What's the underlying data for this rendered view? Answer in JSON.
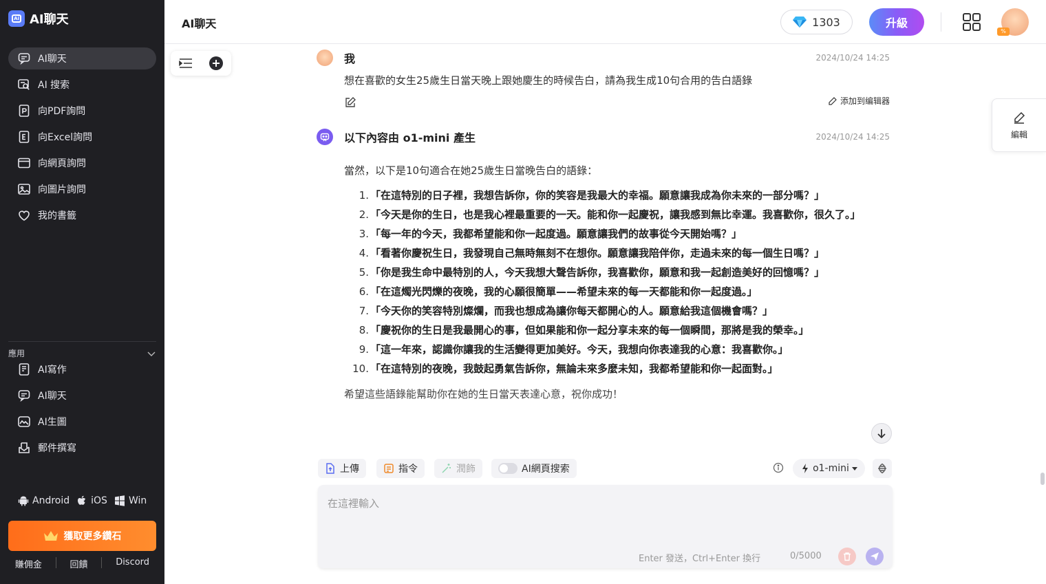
{
  "brand": {
    "name": "AI聊天",
    "logo_text": "Ai"
  },
  "sidebar": {
    "items": [
      {
        "label": "AI聊天",
        "icon": "chat-icon",
        "active": true
      },
      {
        "label": "AI 搜索",
        "icon": "search-icon"
      },
      {
        "label": "向PDF詢問",
        "icon": "pdf-icon"
      },
      {
        "label": "向Excel詢問",
        "icon": "excel-icon"
      },
      {
        "label": "向網頁詢問",
        "icon": "webpage-icon"
      },
      {
        "label": "向圖片詢問",
        "icon": "image-icon"
      },
      {
        "label": "我的書籤",
        "icon": "heart-icon"
      }
    ],
    "apps_label": "應用",
    "apps": [
      {
        "label": "AI寫作",
        "icon": "writing-icon"
      },
      {
        "label": "AI聊天",
        "icon": "chat-icon"
      },
      {
        "label": "AI生圖",
        "icon": "image-gen-icon"
      },
      {
        "label": "郵件撰寫",
        "icon": "mail-icon"
      }
    ],
    "platforms": [
      {
        "label": "Android",
        "icon": "android-icon"
      },
      {
        "label": "iOS",
        "icon": "apple-icon"
      },
      {
        "label": "Win",
        "icon": "windows-icon"
      }
    ],
    "cta_label": "獲取更多鑽石",
    "footer_links": [
      "賺佣金",
      "回饋",
      "Discord"
    ]
  },
  "header": {
    "title": "AI聊天",
    "diamonds": "1303",
    "upgrade_label": "升級",
    "accent_gradient": [
      "#5b8cf7",
      "#8a5cf7",
      "#b04cf0"
    ]
  },
  "edit_tab": {
    "label": "編輯"
  },
  "user_message": {
    "author": "我",
    "time": "2024/10/24 14:25",
    "text": "想在喜歡的女生25歲生日當天晚上跟她慶生的時候告白，請為我生成10句合用的告白語錄",
    "add_to_editor": "添加到编辑器"
  },
  "ai_message": {
    "author": "以下內容由 o1-mini 產生",
    "time": "2024/10/24 14:25",
    "intro": "當然，以下是10句適合在她25歲生日當晚告白的語錄：",
    "items": [
      "「在這特別的日子裡，我想告訴你，你的笑容是我最大的幸福。願意讓我成為你未來的一部分嗎？」",
      "「今天是你的生日，也是我心裡最重要的一天。能和你一起慶祝，讓我感到無比幸運。我喜歡你，很久了。」",
      "「每一年的今天，我都希望能和你一起度過。願意讓我們的故事從今天開始嗎？」",
      "「看著你慶祝生日，我發現自己無時無刻不在想你。願意讓我陪伴你，走過未來的每一個生日嗎？」",
      "「你是我生命中最特別的人，今天我想大聲告訴你，我喜歡你，願意和我一起創造美好的回憶嗎？」",
      "「在這燭光閃爍的夜晚，我的心願很簡單——希望未來的每一天都能和你一起度過。」",
      "「今天你的笑容特別燦爛，而我也想成為讓你每天都開心的人。願意給我這個機會嗎？」",
      "「慶祝你的生日是我最開心的事，但如果能和你一起分享未來的每一個瞬間，那將是我的榮幸。」",
      "「這一年來，認識你讓我的生活變得更加美好。今天，我想向你表達我的心意：我喜歡你。」",
      "「在這特別的夜晚，我鼓起勇氣告訴你，無論未來多麼未知，我都希望能和你一起面對。」"
    ],
    "outro": "希望這些語錄能幫助你在她的生日當天表達心意，祝你成功！"
  },
  "toolbar": {
    "upload": "上傳",
    "command": "指令",
    "polish": "潤飾",
    "web_search": "AI網頁搜索",
    "model": "o1-mini"
  },
  "composer": {
    "placeholder": "在這裡輸入",
    "hint": "Enter 發送，Ctrl+Enter 換行",
    "counter": "0/5000"
  }
}
